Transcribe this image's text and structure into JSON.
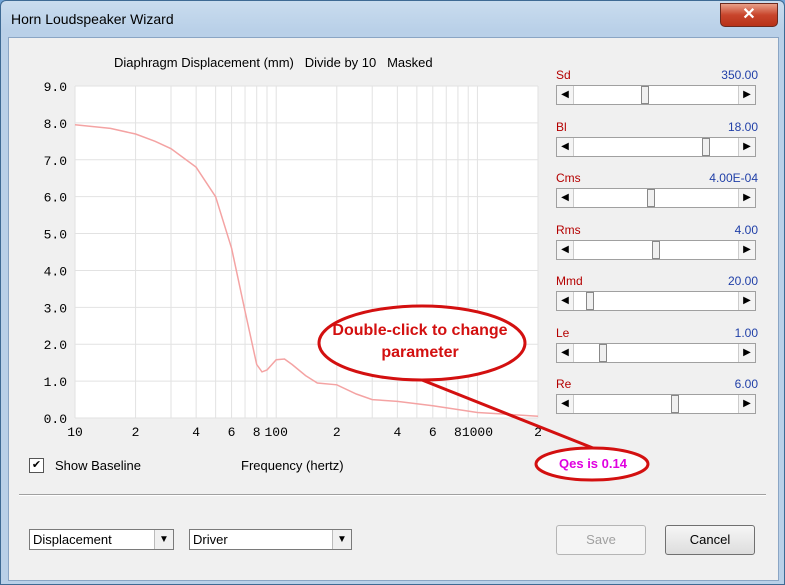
{
  "window": {
    "title": "Horn Loudspeaker Wizard",
    "close_glyph": "✕"
  },
  "chart_title": "Diaphragm Displacement (mm)   Divide by 10   Masked",
  "params": [
    {
      "label": "Sd",
      "value": "350.00",
      "slider_pos": 0.43
    },
    {
      "label": "Bl",
      "value": "18.00",
      "slider_pos": 0.82
    },
    {
      "label": "Cms",
      "value": "4.00E-04",
      "slider_pos": 0.47
    },
    {
      "label": "Rms",
      "value": "4.00",
      "slider_pos": 0.5
    },
    {
      "label": "Mmd",
      "value": "20.00",
      "slider_pos": 0.08
    },
    {
      "label": "Le",
      "value": "1.00",
      "slider_pos": 0.16
    },
    {
      "label": "Re",
      "value": "6.00",
      "slider_pos": 0.62
    }
  ],
  "show_baseline": {
    "label": "Show Baseline",
    "checked_glyph": "✔"
  },
  "frequency_label": "Frequency (hertz)",
  "callout_text": "Double-click to change parameter",
  "qes_text": "Qes is 0.14",
  "dropdowns": {
    "type": "Displacement",
    "source": "Driver",
    "arrow_glyph": "▼"
  },
  "buttons": {
    "save": "Save",
    "cancel": "Cancel"
  },
  "colors": {
    "curve": "#f4a3a3",
    "callout_red": "#d31010",
    "qes": "#e000e0",
    "param_label": "#b40000",
    "param_value": "#2140a8"
  },
  "chart_data": {
    "type": "line",
    "title": "Diaphragm Displacement (mm)   Divide by 10   Masked",
    "xlabel": "Frequency (hertz)",
    "x_scale": "log",
    "xlim": [
      10,
      2000
    ],
    "ylim": [
      0,
      9
    ],
    "x_tick_labels": [
      "10",
      "2",
      "4",
      "6",
      "8",
      "100",
      "2",
      "4",
      "6",
      "8",
      "1000",
      "2"
    ],
    "y_tick_labels": [
      "9.0",
      "8.0",
      "7.0",
      "6.0",
      "5.0",
      "4.0",
      "3.0",
      "2.0",
      "1.0",
      "0.0"
    ],
    "series": [
      {
        "x": [
          10,
          15,
          20,
          25,
          30,
          40,
          50,
          60,
          70,
          80,
          85,
          90,
          100,
          110,
          120,
          140,
          160,
          200,
          250,
          300,
          400,
          600,
          1000,
          2000
        ],
        "y": [
          7.95,
          7.85,
          7.7,
          7.5,
          7.3,
          6.8,
          6.0,
          4.6,
          2.9,
          1.45,
          1.25,
          1.3,
          1.58,
          1.6,
          1.45,
          1.15,
          0.95,
          0.9,
          0.65,
          0.5,
          0.45,
          0.33,
          0.15,
          0.05
        ]
      }
    ]
  }
}
